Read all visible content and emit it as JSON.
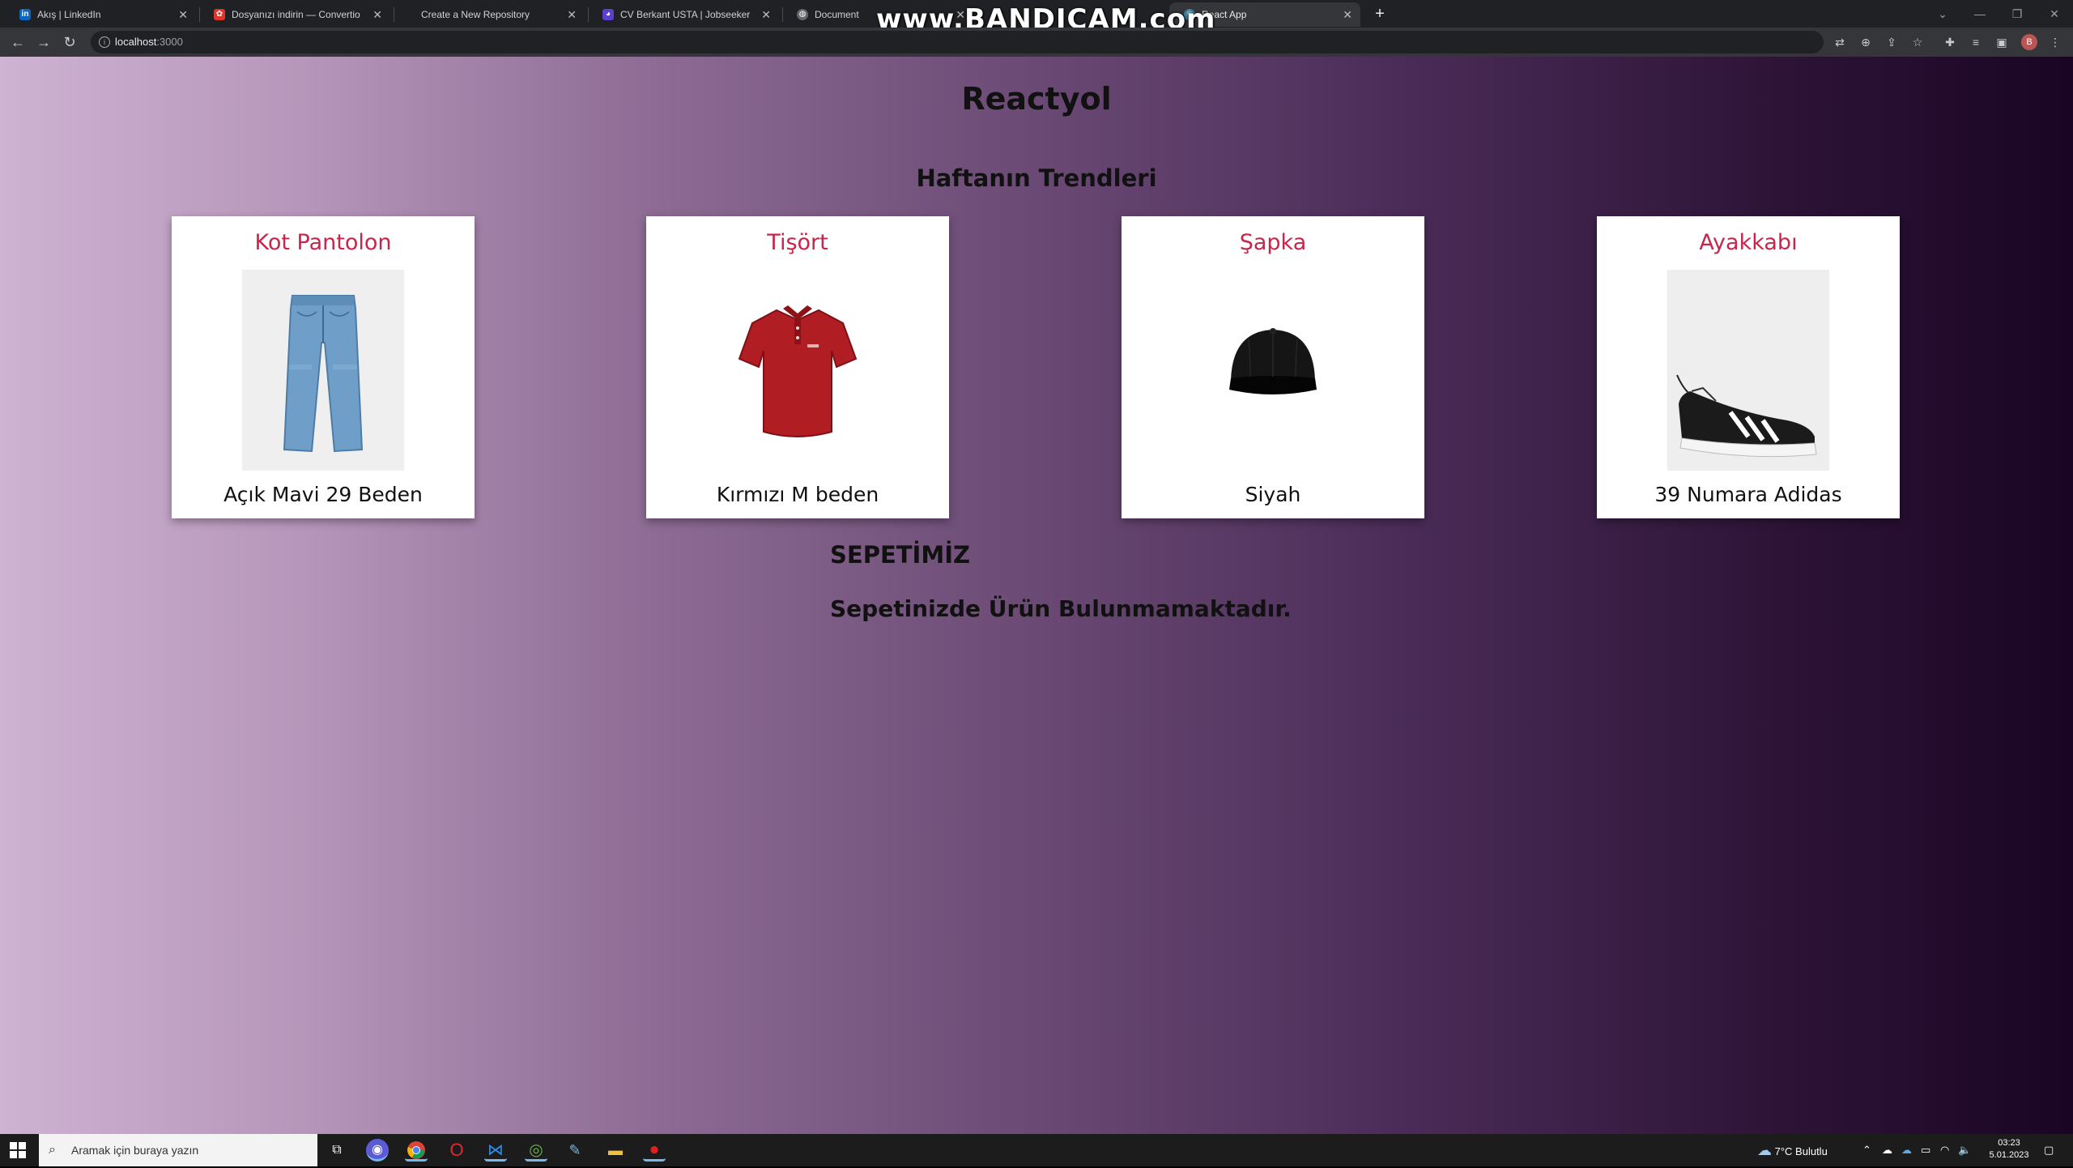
{
  "browser": {
    "tabs": [
      {
        "title": "Akış | LinkedIn",
        "icon": "linkedin-icon",
        "favicon_text": "in",
        "color": "#0a66c2"
      },
      {
        "title": "Dosyanızı indirin — Convertio",
        "icon": "convertio-icon",
        "favicon_text": "✿",
        "color": "#e0352b"
      },
      {
        "title": "Create a New Repository",
        "icon": "github-icon",
        "favicon_text": "",
        "color": "#444"
      },
      {
        "title": "CV Berkant USTA | Jobseeker",
        "icon": "jobseeker-icon",
        "favicon_text": "◕",
        "color": "#5b3fd1"
      },
      {
        "title": "Document",
        "icon": "globe-icon",
        "favicon_text": "◍",
        "color": "#888"
      },
      {
        "title": "React App",
        "icon": "react-icon",
        "favicon_text": "⚛",
        "color": "#3a7f9c",
        "active": true
      }
    ],
    "new_tab": "+",
    "watermark": "www.BANDICAM.com",
    "url_host": "localhost",
    "url_port": ":3000"
  },
  "page": {
    "title": "Reactyol",
    "trends_title": "Haftanın Trendleri",
    "products": [
      {
        "name": "Kot Pantolon",
        "desc": "Açık Mavi 29 Beden",
        "image": "jeans-image"
      },
      {
        "name": "Tişört",
        "desc": "Kırmızı M beden",
        "image": "tshirt-image"
      },
      {
        "name": "Şapka",
        "desc": "Siyah",
        "image": "cap-image"
      },
      {
        "name": "Ayakkabı",
        "desc": "39 Numara Adidas",
        "image": "sneaker-image"
      }
    ],
    "basket_title": "SEPETİMİZ",
    "basket_empty": "Sepetinizde Ürün Bulunmamaktadır.",
    "accent_color": "#c8254a"
  },
  "taskbar": {
    "search_placeholder": "Aramak için buraya yazın",
    "weather": "7°C  Bulutlu",
    "time": "03:23",
    "date": "5.01.2023"
  }
}
